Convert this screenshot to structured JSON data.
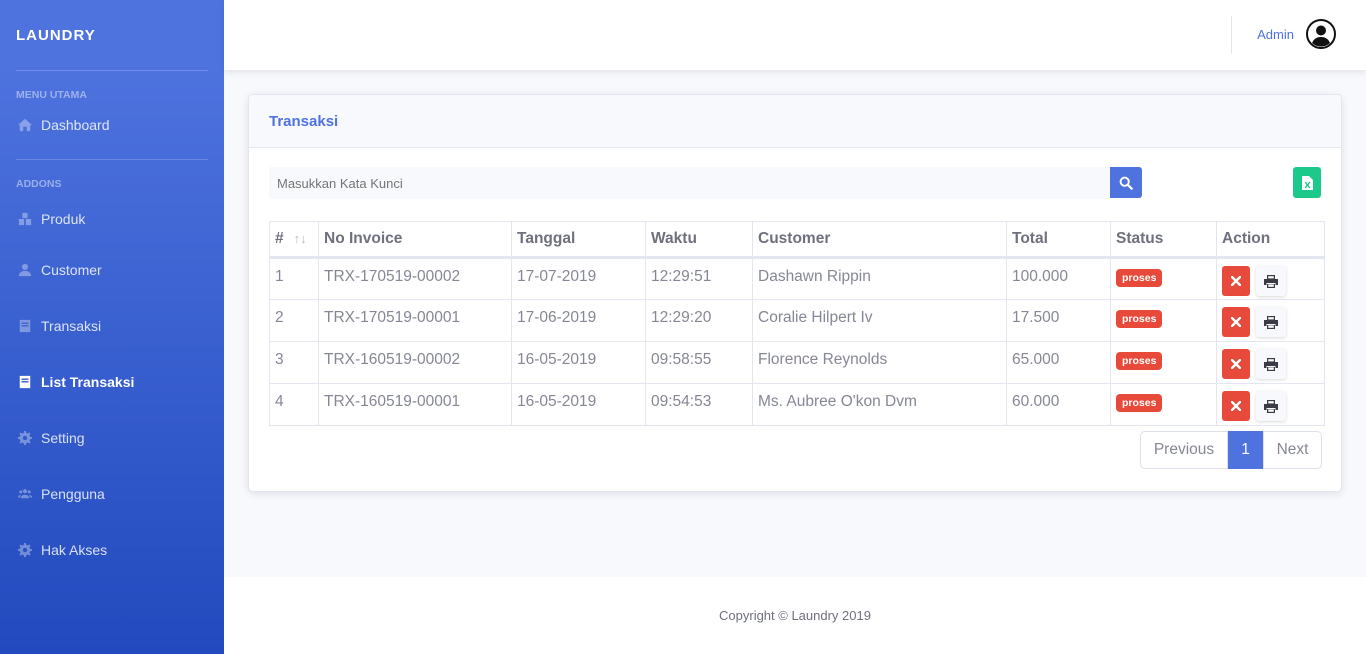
{
  "brand": "LAUNDRY",
  "sidebar": {
    "heading_main": "MENU UTAMA",
    "heading_addons": "ADDONS",
    "items": [
      {
        "label": "Dashboard",
        "icon": "home-icon"
      },
      {
        "label": "Produk",
        "icon": "cubes-icon"
      },
      {
        "label": "Customer",
        "icon": "user-icon"
      },
      {
        "label": "Transaksi",
        "icon": "book-icon"
      },
      {
        "label": "List Transaksi",
        "icon": "book-icon",
        "active": true
      },
      {
        "label": "Setting",
        "icon": "gear-icon"
      },
      {
        "label": "Pengguna",
        "icon": "users-icon"
      },
      {
        "label": "Hak Akses",
        "icon": "gear-icon"
      }
    ]
  },
  "topbar": {
    "user_name": "Admin"
  },
  "card": {
    "title": "Transaksi",
    "search_placeholder": "Masukkan Kata Kunci"
  },
  "table": {
    "columns": [
      "#",
      "No Invoice",
      "Tanggal",
      "Waktu",
      "Customer",
      "Total",
      "Status",
      "Action"
    ],
    "sort_glyph": "↑↓",
    "rows": [
      {
        "no": "1",
        "invoice": "TRX-170519-00002",
        "tanggal": "17-07-2019",
        "waktu": "12:29:51",
        "customer": "Dashawn Rippin",
        "total": "100.000",
        "status": "proses"
      },
      {
        "no": "2",
        "invoice": "TRX-170519-00001",
        "tanggal": "17-06-2019",
        "waktu": "12:29:20",
        "customer": "Coralie Hilpert Iv",
        "total": "17.500",
        "status": "proses"
      },
      {
        "no": "3",
        "invoice": "TRX-160519-00002",
        "tanggal": "16-05-2019",
        "waktu": "09:58:55",
        "customer": "Florence Reynolds",
        "total": "65.000",
        "status": "proses"
      },
      {
        "no": "4",
        "invoice": "TRX-160519-00001",
        "tanggal": "16-05-2019",
        "waktu": "09:54:53",
        "customer": "Ms. Aubree O'kon Dvm",
        "total": "60.000",
        "status": "proses"
      }
    ]
  },
  "pagination": {
    "previous": "Previous",
    "current": "1",
    "next": "Next"
  },
  "footer": "Copyright © Laundry 2019",
  "colors": {
    "primary": "#4e73df",
    "danger": "#e74a3b",
    "success": "#1cc88a"
  }
}
